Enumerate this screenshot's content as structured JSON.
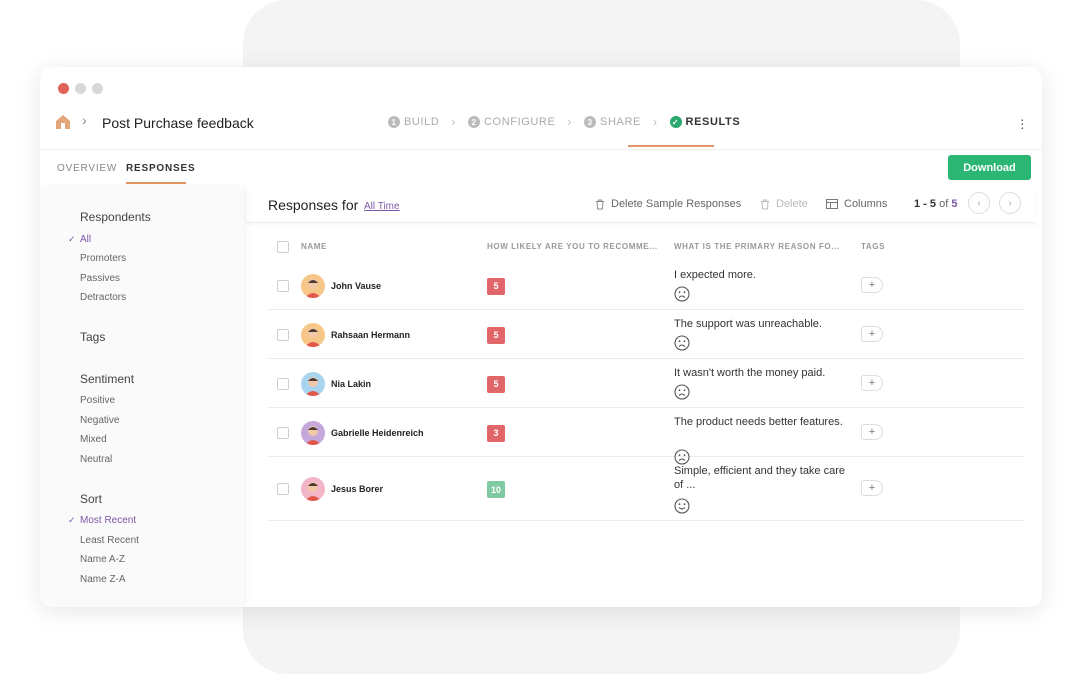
{
  "window": {
    "dot_colors": [
      "#e0625a",
      "#d8d8d8",
      "#d8d8d8"
    ]
  },
  "header": {
    "breadcrumb_separator": "›",
    "title": "Post Purchase feedback",
    "steps": [
      {
        "num": "1",
        "label": "BUILD"
      },
      {
        "num": "2",
        "label": "CONFIGURE"
      },
      {
        "num": "3",
        "label": "SHARE"
      },
      {
        "num": "✓",
        "label": "RESULTS"
      }
    ],
    "step_arrow": "›",
    "menu_icon": "kebab-menu-icon"
  },
  "tabs": {
    "items": [
      "OVERVIEW",
      "RESPONSES"
    ],
    "active": "RESPONSES",
    "download_label": "Download"
  },
  "sidebar": {
    "respondents": {
      "heading": "Respondents",
      "items": [
        "All",
        "Promoters",
        "Passives",
        "Detractors"
      ],
      "selected": "All"
    },
    "tags": {
      "heading": "Tags"
    },
    "sentiment": {
      "heading": "Sentiment",
      "items": [
        "Positive",
        "Negative",
        "Mixed",
        "Neutral"
      ]
    },
    "sort": {
      "heading": "Sort",
      "items": [
        "Most Recent",
        "Least Recent",
        "Name A-Z",
        "Name Z-A"
      ],
      "selected": "Most Recent"
    },
    "check_mark": "✓"
  },
  "toolbar": {
    "title": "Responses for",
    "range_link": "All Time",
    "delete_sample_label": "Delete Sample Responses",
    "delete_label": "Delete",
    "columns_label": "Columns",
    "pager": {
      "range": "1 - 5",
      "of": "of",
      "total": "5"
    },
    "prev_icon": "‹",
    "next_icon": "›"
  },
  "table": {
    "headers": [
      "NAME",
      "HOW LIKELY ARE YOU TO RECOMME...",
      "WHAT IS THE PRIMARY REASON FO...",
      "TAGS"
    ],
    "rows": [
      {
        "name": "John Vause",
        "score": "5",
        "score_color": "#e0666a",
        "reason": "I expected more.",
        "sentiment": "sad",
        "avatar_color": "#f7c78a"
      },
      {
        "name": "Rahsaan Hermann",
        "score": "5",
        "score_color": "#e0666a",
        "reason": "The support was unreachable.",
        "sentiment": "sad",
        "avatar_color": "#f7c78a"
      },
      {
        "name": "Nia Lakin",
        "score": "5",
        "score_color": "#e0666a",
        "reason": "It wasn't worth the money paid.",
        "sentiment": "sad",
        "avatar_color": "#a9d4f0"
      },
      {
        "name": "Gabrielle Heidenreich",
        "score": "3",
        "score_color": "#e0666a",
        "reason": "The product needs better features.",
        "sentiment": "sad",
        "avatar_color": "#c5a7dc"
      },
      {
        "name": "Jesus Borer",
        "score": "10",
        "score_color": "#7fcaa0",
        "reason": "Simple, efficient and they take care of ...",
        "sentiment": "happy",
        "avatar_color": "#f3b6c6"
      }
    ],
    "add_tag_label": "+"
  },
  "colors": {
    "accent": "#7b5aa6",
    "tab_underline": "#e39566",
    "download": "#2bb673",
    "success": "#2aa96e"
  }
}
